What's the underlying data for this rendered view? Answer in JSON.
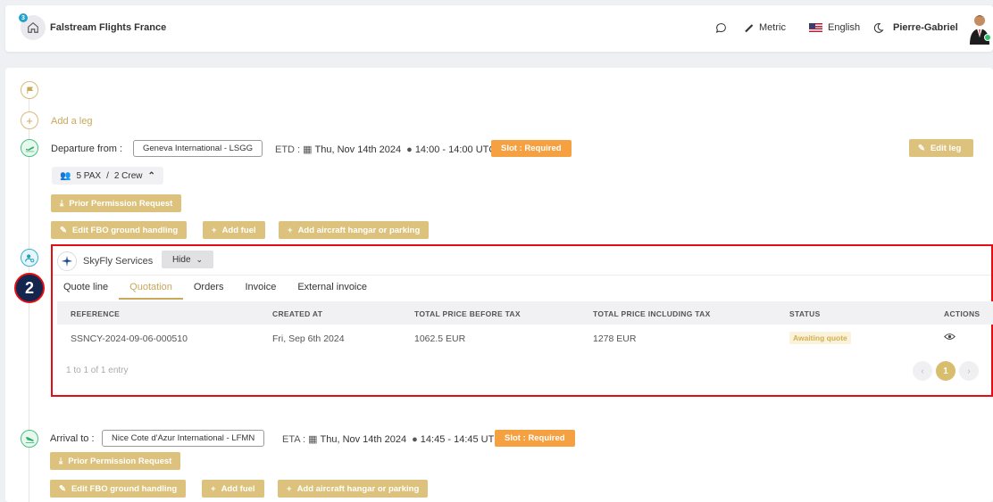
{
  "header": {
    "notification_count": "3",
    "company_name": "Falstream Flights France",
    "units_label": "Metric",
    "language_label": "English",
    "user_name": "Pierre-Gabriel"
  },
  "itinerary": {
    "add_leg_label": "Add a leg",
    "departure": {
      "label": "Departure from",
      "airport": "Geneva International - LSGG",
      "etd_label": "ETD :",
      "date": "Thu, Nov 14th 2024",
      "time": "14:00 - 14:00 UTC",
      "slot": "Slot : Required",
      "edit_leg": "Edit leg",
      "pax": "5 PAX",
      "crew": "2 Crew",
      "buttons": {
        "ppr": "Prior Permission Request",
        "fbo": "Edit FBO ground handling",
        "fuel": "Add fuel",
        "hangar": "Add aircraft hangar or parking"
      }
    },
    "arrival": {
      "label": "Arrival to",
      "airport": "Nice Cote d'Azur International - LFMN",
      "eta_label": "ETA :",
      "date": "Thu, Nov 14th 2024",
      "time": "14:45 - 14:45 UTC",
      "slot": "Slot : Required",
      "buttons": {
        "ppr": "Prior Permission Request",
        "fbo": "Edit FBO ground handling",
        "fuel": "Add fuel",
        "hangar": "Add aircraft hangar or parking"
      }
    }
  },
  "services": {
    "provider": "SkyFly Services",
    "hide_label": "Hide",
    "tabs": [
      "Quote line",
      "Quotation",
      "Orders",
      "Invoice",
      "External invoice"
    ],
    "active_tab": "Quotation",
    "columns": [
      "REFERENCE",
      "CREATED AT",
      "TOTAL PRICE BEFORE TAX",
      "TOTAL PRICE INCLUDING TAX",
      "STATUS",
      "ACTIONS"
    ],
    "rows": [
      {
        "reference": "SSNCY-2024-09-06-000510",
        "created_at": "Fri, Sep 6th 2024",
        "price_before_tax": "1062.5 EUR",
        "price_incl_tax": "1278 EUR",
        "status": "Awaiting quote"
      }
    ],
    "entries_text": "1 to 1 of 1 entry",
    "current_page": "1"
  },
  "annotation": {
    "marker": "2"
  },
  "colors": {
    "gold": "#dcc27c",
    "slot_orange": "#f5a142",
    "highlight_red": "#e10f14",
    "marker_navy": "#14264d"
  }
}
